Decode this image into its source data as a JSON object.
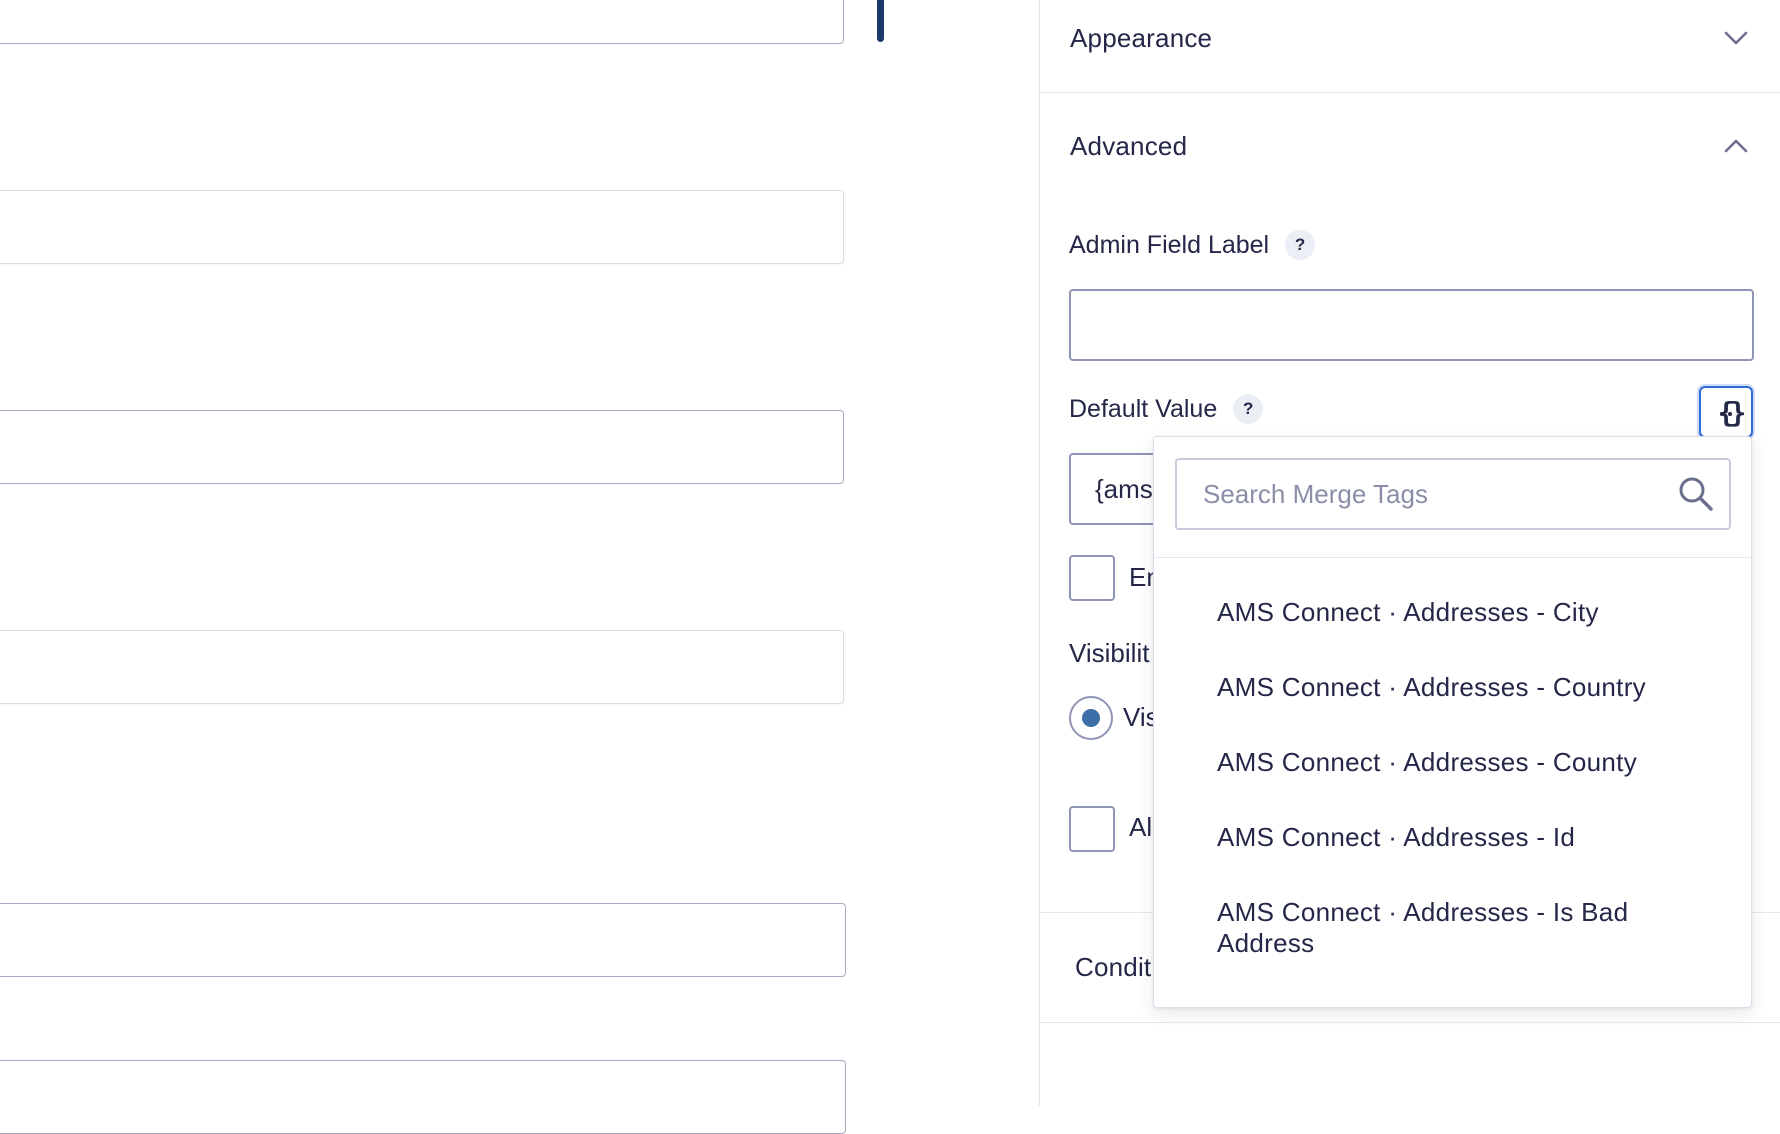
{
  "sidebar": {
    "appearance": {
      "title": "Appearance",
      "icon": "chevron-down-icon"
    },
    "advanced": {
      "title": "Advanced",
      "icon": "chevron-up-icon"
    },
    "admin_field_label": {
      "label": "Admin Field Label",
      "help": "?",
      "value": ""
    },
    "default_value": {
      "label": "Default Value",
      "help": "?",
      "value": "{ams",
      "merge_button_icon": "merge-tags-icon"
    },
    "checkbox_1_text": "En",
    "visibility": {
      "label": "Visibilit",
      "option_text": "Vis",
      "selected": true
    },
    "checkbox_2_text": "Al",
    "conditional": {
      "title": "Condit"
    }
  },
  "merge_tags": {
    "search": {
      "placeholder": "Search Merge Tags",
      "icon": "search-icon"
    },
    "items": [
      "AMS Connect · Addresses - City",
      "AMS Connect · Addresses - Country",
      "AMS Connect · Addresses - County",
      "AMS Connect · Addresses - Id",
      "AMS Connect · Addresses - Is Bad Address"
    ]
  },
  "colors": {
    "text": "#242748",
    "border": "#9095b5",
    "accent": "#2f6bd6",
    "radio": "#3e6fa8",
    "scroll_indicator": "#1d3a6b"
  }
}
